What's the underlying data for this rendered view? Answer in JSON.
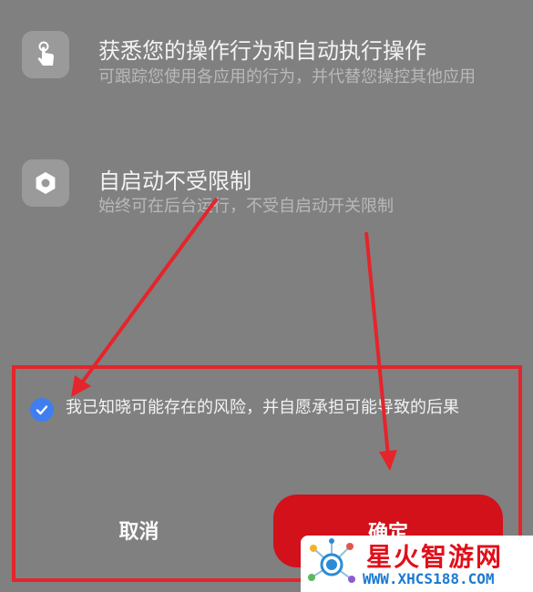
{
  "permissions": [
    {
      "icon": "hand-tap-icon",
      "title": "获悉您的操作行为和自动执行操作",
      "description": "可跟踪您使用各应用的行为，并代替您操控其他应用"
    },
    {
      "icon": "hexagon-settings-icon",
      "title": "自启动不受限制",
      "description": "始终可在后台运行，不受自启动开关限制"
    }
  ],
  "consent": {
    "checked": true,
    "text": "我已知晓可能存在的风险，并自愿承担可能导致的后果"
  },
  "buttons": {
    "cancel_label": "取消",
    "confirm_label": "确定"
  },
  "watermark": {
    "name": "星火智游网",
    "url": "WWW.XHCS188.COM"
  },
  "colors": {
    "background": "#808080",
    "annotation": "#e5242b",
    "confirm_button": "#d2111b",
    "checkbox": "#3f7ef0"
  }
}
